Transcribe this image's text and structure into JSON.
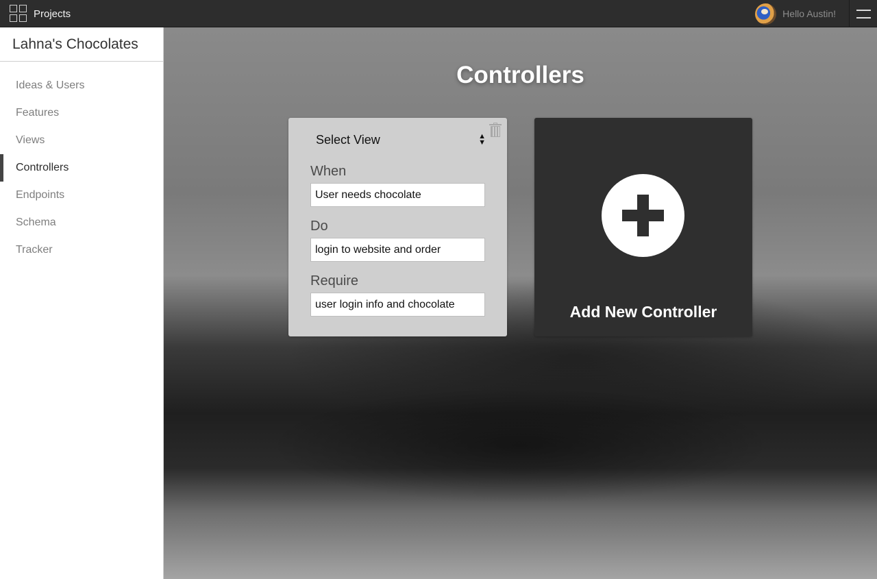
{
  "topbar": {
    "projects_label": "Projects",
    "greeting": "Hello Austin!"
  },
  "sidebar": {
    "title": "Lahna's Chocolates",
    "items": [
      {
        "label": "Ideas & Users",
        "active": false
      },
      {
        "label": "Features",
        "active": false
      },
      {
        "label": "Views",
        "active": false
      },
      {
        "label": "Controllers",
        "active": true
      },
      {
        "label": "Endpoints",
        "active": false
      },
      {
        "label": "Schema",
        "active": false
      },
      {
        "label": "Tracker",
        "active": false
      }
    ]
  },
  "main": {
    "title": "Controllers",
    "controller": {
      "select_label": "Select View",
      "when_label": "When",
      "when_value": "User needs chocolate",
      "do_label": "Do",
      "do_value": "login to website and order",
      "require_label": "Require",
      "require_value": "user login info and chocolate"
    },
    "add_card": {
      "label": "Add New Controller"
    }
  },
  "icons": {
    "projects": "grid-icon",
    "menu": "hamburger-icon",
    "delete": "trash-icon",
    "add": "plus-circle-icon",
    "select": "sort-arrows-icon"
  }
}
